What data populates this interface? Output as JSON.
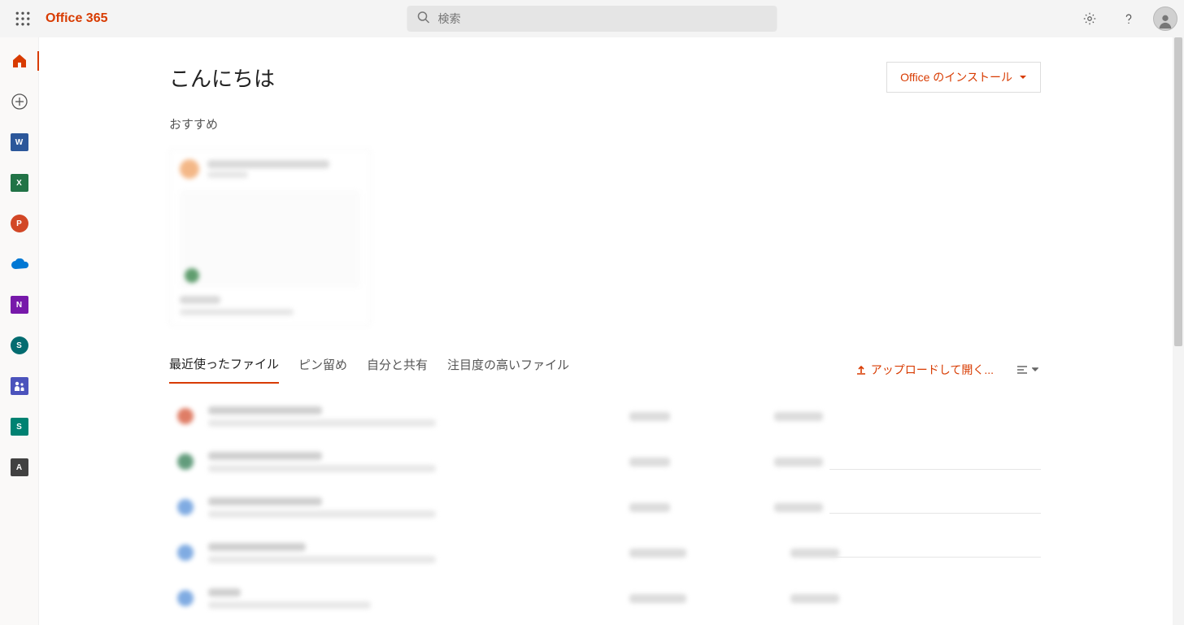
{
  "header": {
    "brand": "Office 365",
    "search_placeholder": "検索"
  },
  "rail": {
    "items": [
      {
        "name": "home",
        "label": "ホーム",
        "color": "#d83b01",
        "letter": ""
      },
      {
        "name": "create",
        "label": "新規作成",
        "color": "transparent",
        "letter": "+"
      },
      {
        "name": "word",
        "label": "Word",
        "color": "#2b579a",
        "letter": "W"
      },
      {
        "name": "excel",
        "label": "Excel",
        "color": "#217346",
        "letter": "X"
      },
      {
        "name": "powerpoint",
        "label": "PowerPoint",
        "color": "#d24726",
        "letter": "P"
      },
      {
        "name": "onedrive",
        "label": "OneDrive",
        "color": "#0078d4",
        "letter": ""
      },
      {
        "name": "onenote",
        "label": "OneNote",
        "color": "#7719aa",
        "letter": "N"
      },
      {
        "name": "sharepoint",
        "label": "SharePoint",
        "color": "#036c70",
        "letter": "S"
      },
      {
        "name": "teams",
        "label": "Teams",
        "color": "#4b53bc",
        "letter": ""
      },
      {
        "name": "sway",
        "label": "Sway",
        "color": "#008272",
        "letter": "S"
      },
      {
        "name": "admin",
        "label": "管理",
        "color": "#414141",
        "letter": "A"
      }
    ]
  },
  "main": {
    "greeting": "こんにちは",
    "install_label": "Office のインストール",
    "recommended_label": "おすすめ",
    "tabs": [
      {
        "label": "最近使ったファイル",
        "active": true
      },
      {
        "label": "ピン留め",
        "active": false
      },
      {
        "label": "自分と共有",
        "active": false
      },
      {
        "label": "注目度の高いファイル",
        "active": false
      }
    ],
    "upload_label": "アップロードして開く...",
    "file_list": [
      {
        "icon_color": "#d24726"
      },
      {
        "icon_color": "#217346"
      },
      {
        "icon_color": "#4a88d6"
      },
      {
        "icon_color": "#4a88d6"
      },
      {
        "icon_color": "#4a88d6"
      }
    ]
  }
}
